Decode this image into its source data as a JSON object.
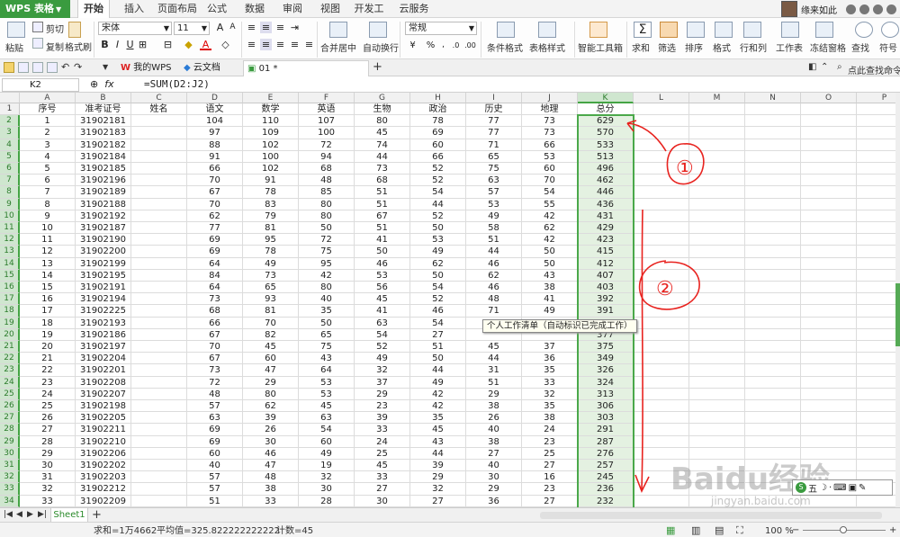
{
  "app": {
    "name": "WPS 表格",
    "menu_tabs": [
      "开始",
      "插入",
      "页面布局",
      "公式",
      "数据",
      "审阅",
      "视图",
      "开发工具",
      "云服务"
    ],
    "active_menu": "开始",
    "user": "缘来如此"
  },
  "ribbon": {
    "paste": "粘贴",
    "cut": "剪切",
    "copy": "复制",
    "format_painter": "格式刷",
    "font_name": "宋体",
    "font_size": "11",
    "merge_center": "合并居中",
    "wrap_text": "自动换行",
    "number_format": "常规",
    "conditional_format": "条件格式",
    "table_style": "表格样式",
    "smart_tools": "智能工具箱",
    "sum": "求和",
    "filter": "筛选",
    "sort": "排序",
    "format": "格式",
    "row_col": "行和列",
    "worksheet": "工作表",
    "freeze": "冻结窗格",
    "find": "查找",
    "symbol": "符号"
  },
  "doc_tabs": [
    {
      "label": "我的WPS"
    },
    {
      "label": "云文档"
    },
    {
      "label": "01 *"
    }
  ],
  "help_text": "点此查找命令",
  "formula_bar": {
    "cell_ref": "K2",
    "fx": "fx",
    "formula": "=SUM(D2:J2)"
  },
  "columns": [
    "A",
    "B",
    "C",
    "D",
    "E",
    "F",
    "G",
    "H",
    "I",
    "J",
    "K",
    "L",
    "M",
    "N",
    "O",
    "P"
  ],
  "headers": [
    "序号",
    "准考证号",
    "姓名",
    "语文",
    "数学",
    "英语",
    "生物",
    "政治",
    "历史",
    "地理",
    "总分"
  ],
  "rows": [
    [
      "1",
      "31902181",
      "",
      "104",
      "110",
      "107",
      "80",
      "78",
      "77",
      "73",
      "629"
    ],
    [
      "2",
      "31902183",
      "",
      "97",
      "109",
      "100",
      "45",
      "69",
      "77",
      "73",
      "570"
    ],
    [
      "3",
      "31902182",
      "",
      "88",
      "102",
      "72",
      "74",
      "60",
      "71",
      "66",
      "533"
    ],
    [
      "4",
      "31902184",
      "",
      "91",
      "100",
      "94",
      "44",
      "66",
      "65",
      "53",
      "513"
    ],
    [
      "5",
      "31902185",
      "",
      "66",
      "102",
      "68",
      "73",
      "52",
      "75",
      "60",
      "496"
    ],
    [
      "6",
      "31902196",
      "",
      "70",
      "91",
      "48",
      "68",
      "52",
      "63",
      "70",
      "462"
    ],
    [
      "7",
      "31902189",
      "",
      "67",
      "78",
      "85",
      "51",
      "54",
      "57",
      "54",
      "446"
    ],
    [
      "8",
      "31902188",
      "",
      "70",
      "83",
      "80",
      "51",
      "44",
      "53",
      "55",
      "436"
    ],
    [
      "9",
      "31902192",
      "",
      "62",
      "79",
      "80",
      "67",
      "52",
      "49",
      "42",
      "431"
    ],
    [
      "10",
      "31902187",
      "",
      "77",
      "81",
      "50",
      "51",
      "50",
      "58",
      "62",
      "429"
    ],
    [
      "11",
      "31902190",
      "",
      "69",
      "95",
      "72",
      "41",
      "53",
      "51",
      "42",
      "423"
    ],
    [
      "12",
      "31902200",
      "",
      "69",
      "78",
      "75",
      "50",
      "49",
      "44",
      "50",
      "415"
    ],
    [
      "13",
      "31902199",
      "",
      "64",
      "49",
      "95",
      "46",
      "62",
      "46",
      "50",
      "412"
    ],
    [
      "14",
      "31902195",
      "",
      "84",
      "73",
      "42",
      "53",
      "50",
      "62",
      "43",
      "407"
    ],
    [
      "15",
      "31902191",
      "",
      "64",
      "65",
      "80",
      "56",
      "54",
      "46",
      "38",
      "403"
    ],
    [
      "16",
      "31902194",
      "",
      "73",
      "93",
      "40",
      "45",
      "52",
      "48",
      "41",
      "392"
    ],
    [
      "17",
      "31902225",
      "",
      "68",
      "81",
      "35",
      "41",
      "46",
      "71",
      "49",
      "391"
    ],
    [
      "18",
      "31902193",
      "",
      "66",
      "70",
      "50",
      "63",
      "54",
      "48",
      "36",
      "387"
    ],
    [
      "19",
      "31902186",
      "",
      "67",
      "82",
      "65",
      "54",
      "27",
      "",
      "",
      "377"
    ],
    [
      "20",
      "31902197",
      "",
      "70",
      "45",
      "75",
      "52",
      "51",
      "45",
      "37",
      "375"
    ],
    [
      "21",
      "31902204",
      "",
      "67",
      "60",
      "43",
      "49",
      "50",
      "44",
      "36",
      "349"
    ],
    [
      "22",
      "31902201",
      "",
      "73",
      "47",
      "64",
      "32",
      "44",
      "31",
      "35",
      "326"
    ],
    [
      "23",
      "31902208",
      "",
      "72",
      "29",
      "53",
      "37",
      "49",
      "51",
      "33",
      "324"
    ],
    [
      "24",
      "31902207",
      "",
      "48",
      "80",
      "53",
      "29",
      "42",
      "29",
      "32",
      "313"
    ],
    [
      "25",
      "31902198",
      "",
      "57",
      "62",
      "45",
      "23",
      "42",
      "38",
      "35",
      "306"
    ],
    [
      "26",
      "31902205",
      "",
      "63",
      "39",
      "63",
      "39",
      "35",
      "26",
      "38",
      "303"
    ],
    [
      "27",
      "31902211",
      "",
      "69",
      "26",
      "54",
      "33",
      "45",
      "40",
      "24",
      "291"
    ],
    [
      "28",
      "31902210",
      "",
      "69",
      "30",
      "60",
      "24",
      "43",
      "38",
      "23",
      "287"
    ],
    [
      "29",
      "31902206",
      "",
      "60",
      "46",
      "49",
      "25",
      "44",
      "27",
      "25",
      "276"
    ],
    [
      "30",
      "31902202",
      "",
      "40",
      "47",
      "19",
      "45",
      "39",
      "40",
      "27",
      "257"
    ],
    [
      "31",
      "31902203",
      "",
      "57",
      "48",
      "32",
      "33",
      "29",
      "30",
      "16",
      "245"
    ],
    [
      "32",
      "31902212",
      "",
      "57",
      "38",
      "30",
      "27",
      "32",
      "29",
      "23",
      "236"
    ],
    [
      "33",
      "31902209",
      "",
      "51",
      "33",
      "28",
      "30",
      "27",
      "36",
      "27",
      "232"
    ],
    [
      "34",
      "31902219",
      "",
      "37",
      "21",
      "32",
      "30",
      "38",
      "32",
      "25",
      "225"
    ],
    [
      "35",
      "31902214",
      "",
      "54",
      "11",
      "35",
      "30",
      "44",
      "20",
      "27",
      "221"
    ]
  ],
  "tooltip": "个人工作清单（自动标识已完成工作）",
  "sheet_tab": "Sheet1",
  "status": {
    "sum": "求和=1万4662",
    "average": "平均值=325.822222222222",
    "count": "计数=45",
    "zoom": "100 %"
  },
  "annotations": [
    "①",
    "②"
  ],
  "watermark": "Baidu经验",
  "watermark_url": "jingyan.baidu.com",
  "colors": {
    "accent": "#3a9b3f",
    "selection": "#4aa84a",
    "annotation": "#e8231f"
  }
}
